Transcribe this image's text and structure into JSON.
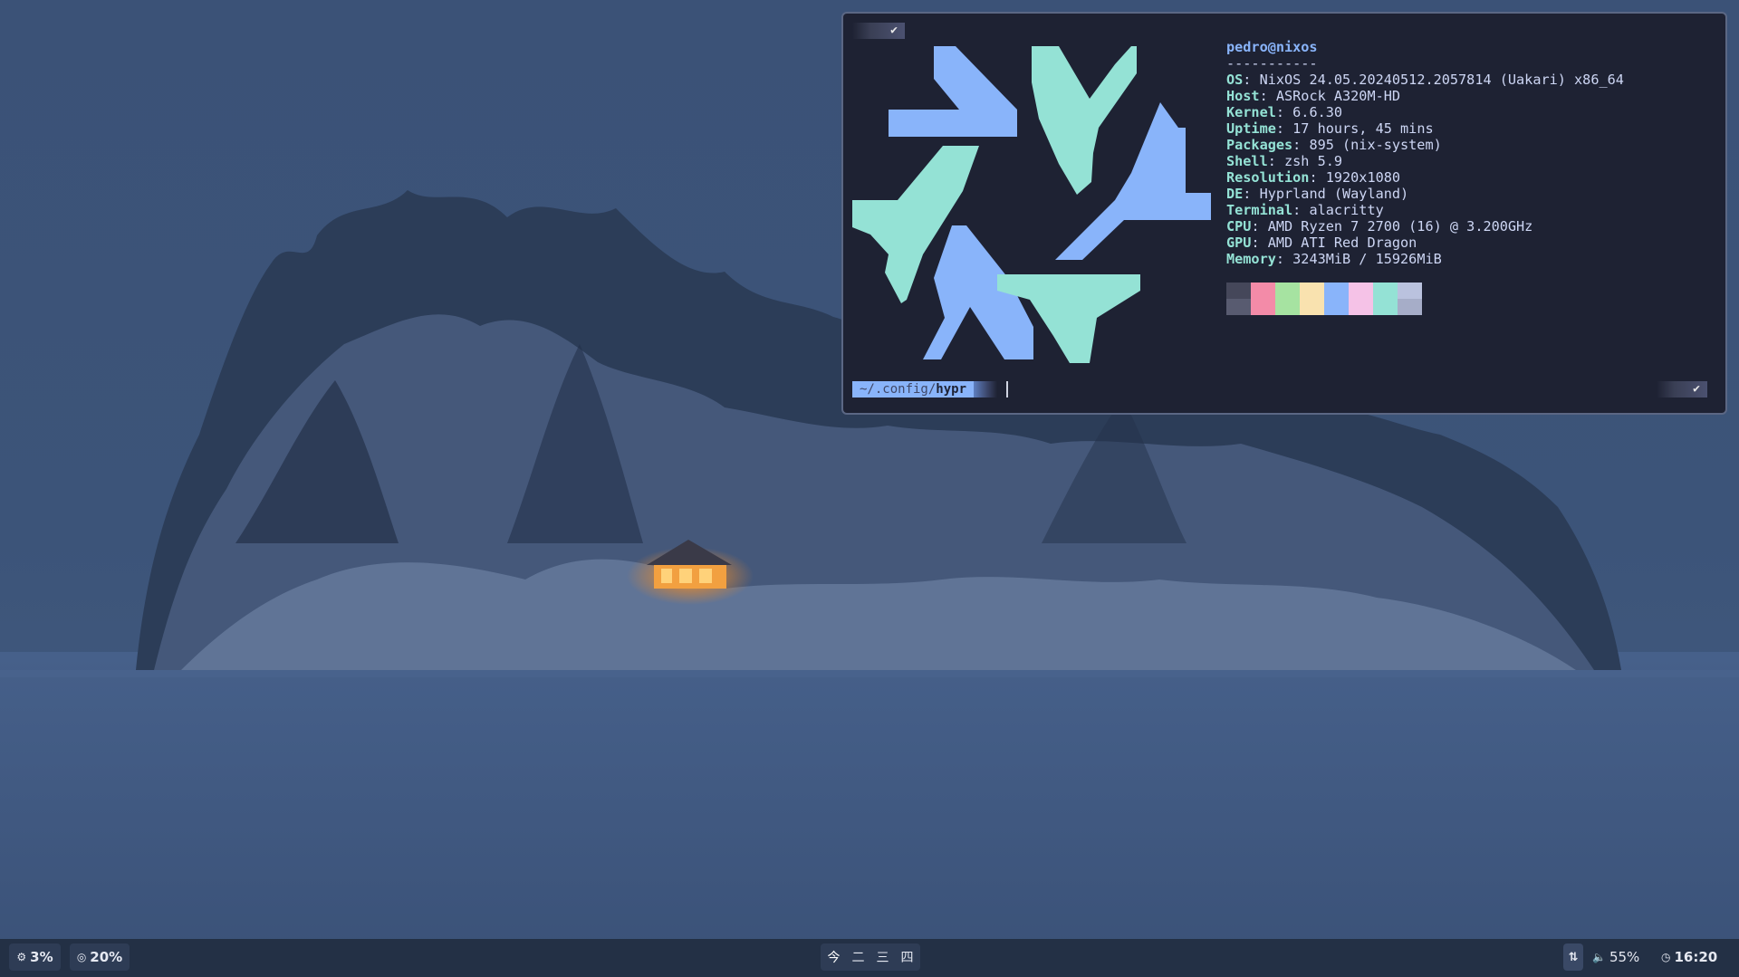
{
  "terminal": {
    "top_status": "✔",
    "user_host": "pedro@nixos",
    "separator": "-----------",
    "info": [
      {
        "key": "OS",
        "value": ": NixOS 24.05.20240512.2057814 (Uakari) x86_64"
      },
      {
        "key": "Host",
        "value": ": ASRock A320M-HD"
      },
      {
        "key": "Kernel",
        "value": ": 6.6.30"
      },
      {
        "key": "Uptime",
        "value": ": 17 hours, 45 mins"
      },
      {
        "key": "Packages",
        "value": ": 895 (nix-system)"
      },
      {
        "key": "Shell",
        "value": ": zsh 5.9"
      },
      {
        "key": "Resolution",
        "value": ": 1920x1080"
      },
      {
        "key": "DE",
        "value": ": Hyprland (Wayland)"
      },
      {
        "key": "Terminal",
        "value": ": alacritty"
      },
      {
        "key": "CPU",
        "value": ": AMD Ryzen 7 2700 (16) @ 3.200GHz"
      },
      {
        "key": "GPU",
        "value": ": AMD ATI Red Dragon"
      },
      {
        "key": "Memory",
        "value": ": 3243MiB / 15926MiB"
      }
    ],
    "palette": [
      [
        "#45475a",
        "#585b70"
      ],
      [
        "#f38ba8",
        "#f38ba8"
      ],
      [
        "#a6e3a1",
        "#a6e3a1"
      ],
      [
        "#f9e2af",
        "#f9e2af"
      ],
      [
        "#89b4fa",
        "#89b4fa"
      ],
      [
        "#f5c2e7",
        "#f5c2e7"
      ],
      [
        "#94e2d5",
        "#94e2d5"
      ],
      [
        "#bac2de",
        "#a6adc8"
      ]
    ],
    "logo_colors": {
      "blue": "#89b4fa",
      "teal": "#94e2d5"
    },
    "prompt": {
      "dir_prefix": "~/.config/",
      "dir_bold": "hypr"
    },
    "right_status": "✔"
  },
  "bar": {
    "cpu": {
      "icon": "cpu-icon",
      "value": "3%"
    },
    "disk": {
      "icon": "disk-icon",
      "value": "20%"
    },
    "workspaces": [
      "今",
      "二",
      "三",
      "四"
    ],
    "network_icon": "network-icon",
    "volume": {
      "icon": "speaker-icon",
      "value": "55%"
    },
    "clock": {
      "icon": "clock-icon",
      "value": "16:20"
    }
  }
}
